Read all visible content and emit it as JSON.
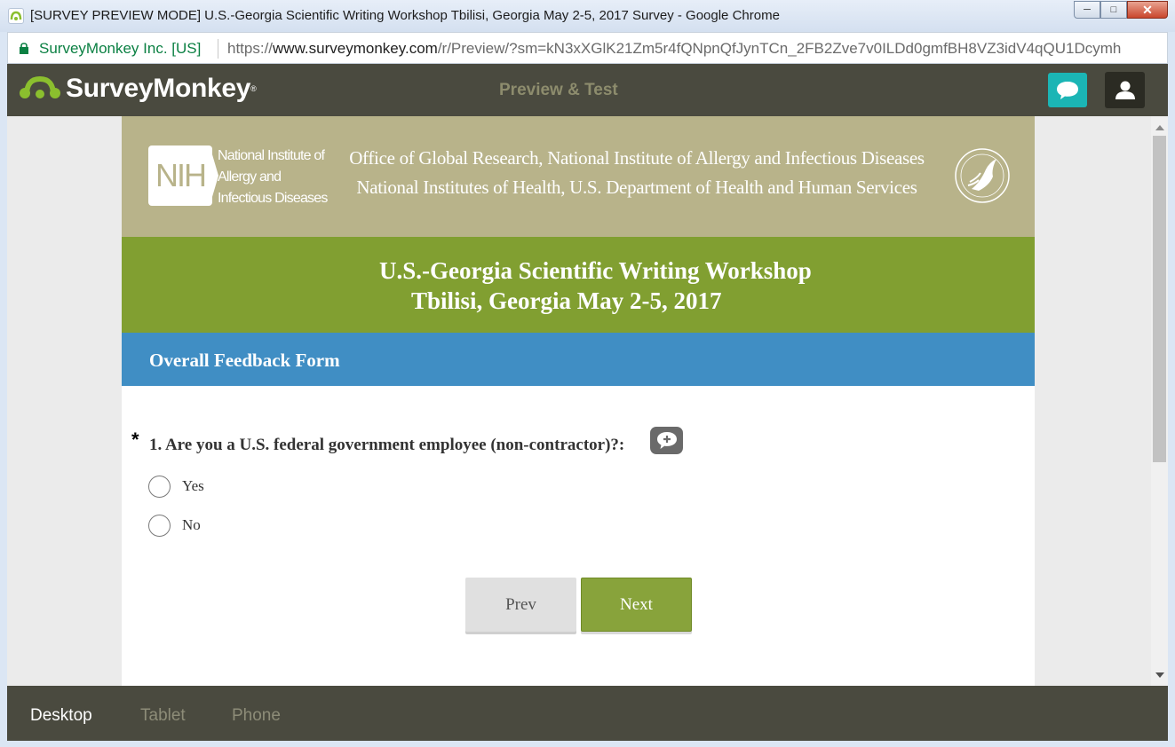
{
  "window": {
    "title": "[SURVEY PREVIEW MODE] U.S.-Georgia Scientific Writing Workshop Tbilisi, Georgia May 2-5, 2017 Survey - Google Chrome",
    "favicon": "surveymonkey-favicon",
    "controls": {
      "minimize": "minimize-icon",
      "maximize": "maximize-icon",
      "close": "close-icon"
    }
  },
  "addressbar": {
    "secure_label": "SurveyMonkey Inc. [US]",
    "url_scheme": "https://",
    "url_host": "www.surveymonkey.com",
    "url_path": "/r/Preview/?sm=kN3xXGlK21Zm5r4fQNpnQfJynTCn_2FB2Zve7v0ILDd0gmfBH8VZ3idV4qQU1Dcymh"
  },
  "header": {
    "logo_text": "SurveyMonkey",
    "logo_reg": "®",
    "center_label": "Preview & Test",
    "comment_icon": "speech-bubble-icon",
    "user_icon": "user-icon"
  },
  "banner": {
    "nih_logo": "NIH",
    "institute_lines": [
      "National Institute of",
      "Allergy and",
      "Infectious Diseases"
    ],
    "office_line1": "Office of Global Research, National Institute of Allergy and Infectious Diseases",
    "office_line2": "National Institutes of Health, U.S. Department of Health and Human Services",
    "seal_icon": "hhs-seal-icon"
  },
  "survey": {
    "title_line1": "U.S.-Georgia Scientific Writing Workshop",
    "title_line2": "Tbilisi, Georgia May 2-5, 2017",
    "page_title": "Overall Feedback Form"
  },
  "question": {
    "required_marker": "*",
    "text": "1. Are you a U.S. federal government employee (non-contractor)?:",
    "comment_icon": "add-comment-icon",
    "options": [
      {
        "label": "Yes",
        "selected": false
      },
      {
        "label": "No",
        "selected": false
      }
    ]
  },
  "navigation": {
    "prev_label": "Prev",
    "next_label": "Next"
  },
  "device_bar": {
    "tabs": [
      {
        "label": "Desktop",
        "active": true
      },
      {
        "label": "Tablet",
        "active": false
      },
      {
        "label": "Phone",
        "active": false
      }
    ]
  },
  "colors": {
    "header_bg": "#4a4a3f",
    "banner_bg": "#b8b38a",
    "title_band": "#819f31",
    "page_band": "#408ec4",
    "next_button": "#88a33b",
    "comment_button": "#1bb5b5"
  }
}
